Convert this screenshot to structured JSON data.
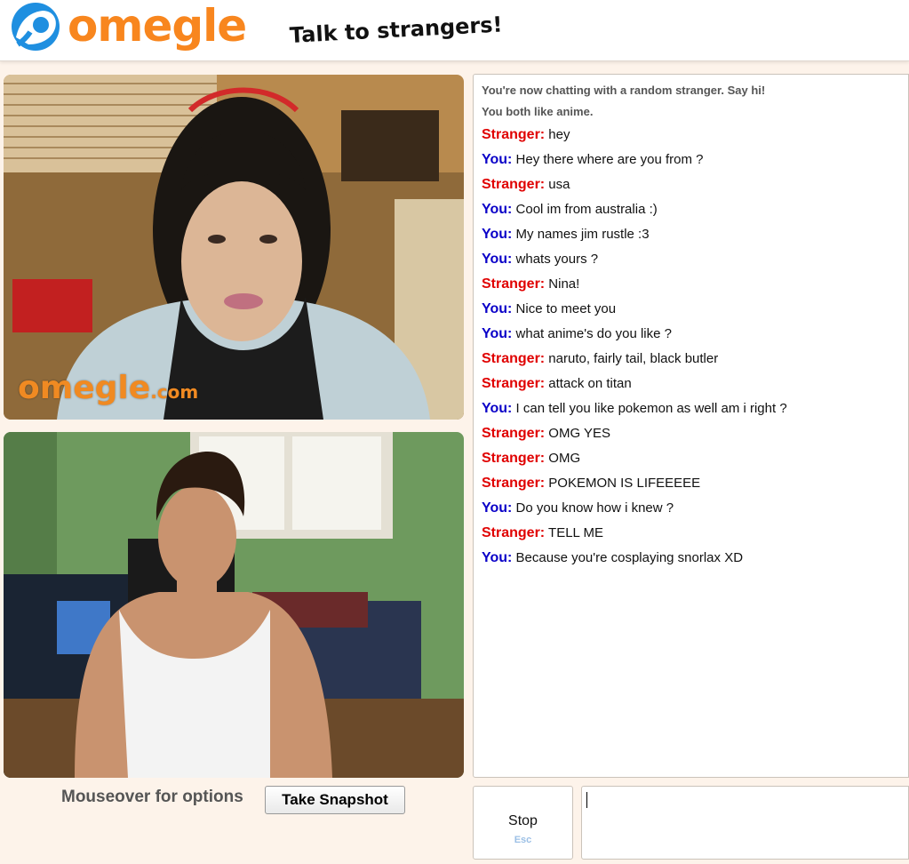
{
  "header": {
    "logo_text": "omegle",
    "tagline": "Talk to strangers!"
  },
  "video": {
    "watermark_main": "omegle",
    "watermark_suffix": ".com",
    "mouseover_text": "Mouseover for options",
    "snapshot_label": "Take Snapshot"
  },
  "chat": {
    "system": [
      "You're now chatting with a random stranger. Say hi!",
      "You both like anime."
    ],
    "messages": [
      {
        "who": "Stranger:",
        "role": "stranger",
        "text": "hey"
      },
      {
        "who": "You:",
        "role": "you",
        "text": "Hey there where are you from ?"
      },
      {
        "who": "Stranger:",
        "role": "stranger",
        "text": "usa"
      },
      {
        "who": "You:",
        "role": "you",
        "text": "Cool im from australia :)"
      },
      {
        "who": "You:",
        "role": "you",
        "text": "My names jim rustle :3"
      },
      {
        "who": "You:",
        "role": "you",
        "text": "whats yours ?"
      },
      {
        "who": "Stranger:",
        "role": "stranger",
        "text": "Nina!"
      },
      {
        "who": "You:",
        "role": "you",
        "text": "Nice to meet you"
      },
      {
        "who": "You:",
        "role": "you",
        "text": "what anime's do you like ?"
      },
      {
        "who": "Stranger:",
        "role": "stranger",
        "text": "naruto, fairly tail, black butler"
      },
      {
        "who": "Stranger:",
        "role": "stranger",
        "text": "attack on titan"
      },
      {
        "who": "You:",
        "role": "you",
        "text": "I can tell you like pokemon as well am i right ?"
      },
      {
        "who": "Stranger:",
        "role": "stranger",
        "text": "OMG YES"
      },
      {
        "who": "Stranger:",
        "role": "stranger",
        "text": "OMG"
      },
      {
        "who": "Stranger:",
        "role": "stranger",
        "text": "POKEMON IS LIFEEEEE"
      },
      {
        "who": "You:",
        "role": "you",
        "text": "Do you know how i knew ?"
      },
      {
        "who": "Stranger:",
        "role": "stranger",
        "text": "TELL ME"
      },
      {
        "who": "You:",
        "role": "you",
        "text": "Because you're cosplaying snorlax XD"
      }
    ]
  },
  "controls": {
    "stop_label": "Stop",
    "stop_key": "Esc",
    "input_value": ""
  },
  "colors": {
    "brand_orange": "#f8861e",
    "logo_blue": "#1f8fe0",
    "stranger_red": "#e00000",
    "you_blue": "#0a00c8"
  }
}
